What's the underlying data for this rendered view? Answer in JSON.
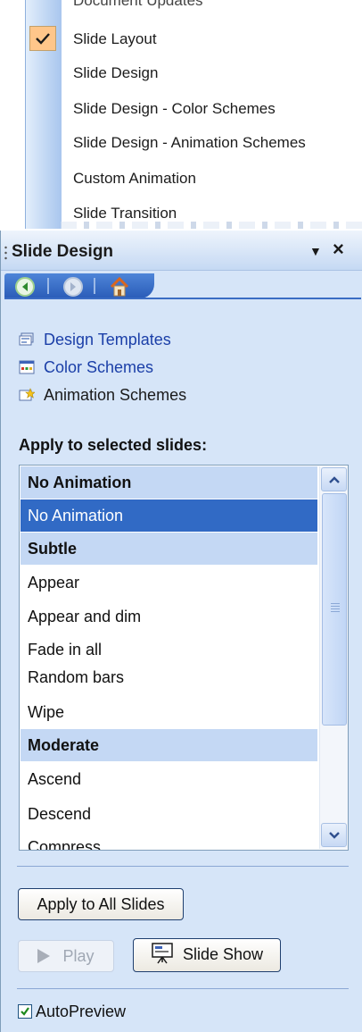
{
  "menu": {
    "items": [
      {
        "label": "Document Updates",
        "checked": false,
        "cut": true
      },
      {
        "label": "Slide Layout",
        "checked": true
      },
      {
        "label": "Slide Design",
        "checked": false
      },
      {
        "label": "Slide Design - Color Schemes",
        "checked": false
      },
      {
        "label": "Slide Design - Animation Schemes",
        "checked": false
      },
      {
        "label": "Custom Animation",
        "checked": false
      },
      {
        "label": "Slide Transition",
        "checked": false
      }
    ]
  },
  "pane": {
    "title": "Slide Design",
    "menu_arrow": "▼",
    "close": "×",
    "nav": {
      "back": "back-icon",
      "forward": "forward-icon",
      "home": "home-icon"
    },
    "links": [
      {
        "label": "Design Templates",
        "icon": "design-templates-icon",
        "active": true
      },
      {
        "label": "Color Schemes",
        "icon": "color-schemes-icon",
        "active": true
      },
      {
        "label": "Animation Schemes",
        "icon": "animation-schemes-icon",
        "active": false
      }
    ],
    "apply_label": "Apply to selected slides:",
    "list": [
      {
        "label": "No Animation",
        "type": "group"
      },
      {
        "label": "No Animation",
        "type": "selected"
      },
      {
        "label": "Subtle",
        "type": "group"
      },
      {
        "label": "Appear",
        "type": "item"
      },
      {
        "label": "Appear and dim",
        "type": "item"
      },
      {
        "label": "Fade in all",
        "type": "item"
      },
      {
        "label": "Random bars",
        "type": "item"
      },
      {
        "label": "Wipe",
        "type": "item"
      },
      {
        "label": "Moderate",
        "type": "group"
      },
      {
        "label": "Ascend",
        "type": "item"
      },
      {
        "label": "Descend",
        "type": "item"
      },
      {
        "label": "Compress",
        "type": "item"
      }
    ],
    "buttons": {
      "apply_all": "Apply to All Slides",
      "play": "Play",
      "slide_show": "Slide Show"
    },
    "autopreview": {
      "label": "AutoPreview",
      "checked": true
    }
  },
  "colors": {
    "selection": "#316ac5",
    "group_bg": "#c4d8f4",
    "pane_bg": "#d6e5f8",
    "link": "#1b3fa8"
  }
}
